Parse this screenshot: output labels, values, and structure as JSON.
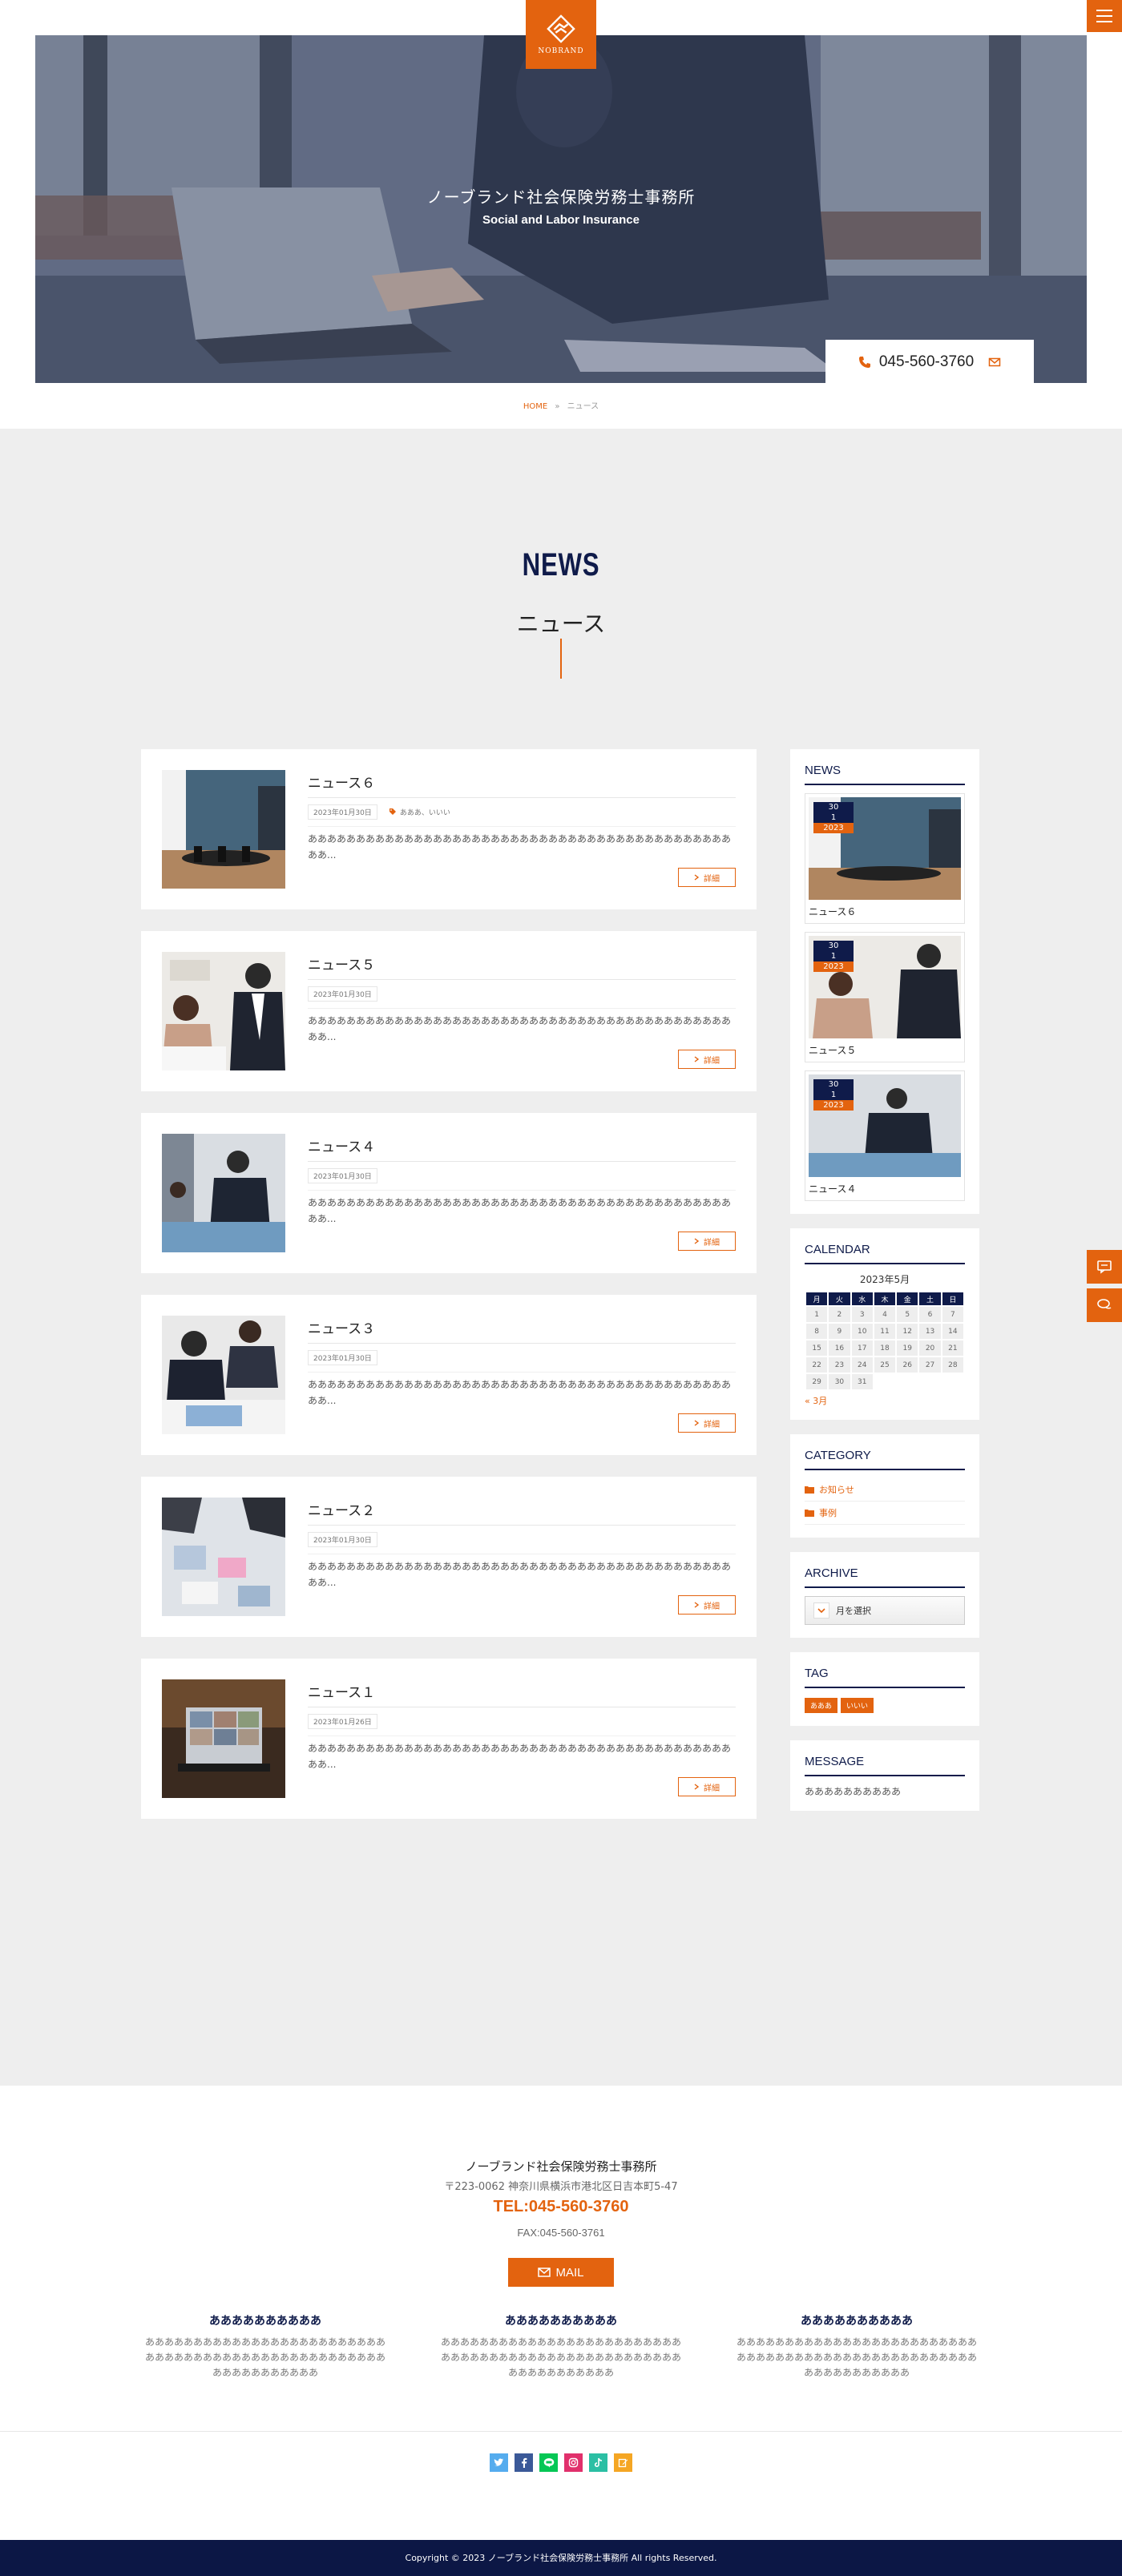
{
  "site": {
    "brand": "NOBRAND",
    "hero_title": "ノーブランド社会保険労務士事務所",
    "hero_subtitle": "Social and Labor Insurance",
    "tel": "045-560-3760"
  },
  "breadcrumb": {
    "home": "HOME",
    "sep": "»",
    "current": "ニュース"
  },
  "section": {
    "title_en": "NEWS",
    "title_jp": "ニュース"
  },
  "posts": [
    {
      "title": "ニュース６",
      "date": "2023年01月30日",
      "tag": "あああ、いいい",
      "excerpt": "ああああああああああああああああああああああああああああああああああああああああああああああ...",
      "more": "詳細"
    },
    {
      "title": "ニュース５",
      "date": "2023年01月30日",
      "tag": "",
      "excerpt": "ああああああああああああああああああああああああああああああああああああああああああああああ...",
      "more": "詳細"
    },
    {
      "title": "ニュース４",
      "date": "2023年01月30日",
      "tag": "",
      "excerpt": "ああああああああああああああああああああああああああああああああああああああああああああああ...",
      "more": "詳細"
    },
    {
      "title": "ニュース３",
      "date": "2023年01月30日",
      "tag": "",
      "excerpt": "ああああああああああああああああああああああああああああああああああああああああああああああ...",
      "more": "詳細"
    },
    {
      "title": "ニュース２",
      "date": "2023年01月30日",
      "tag": "",
      "excerpt": "ああああああああああああああああああああああああああああああああああああああああああああああ...",
      "more": "詳細"
    },
    {
      "title": "ニュース１",
      "date": "2023年01月26日",
      "tag": "",
      "excerpt": "ああああああああああああああああああああああああああああああああああああああああああああああ...",
      "more": "詳細"
    }
  ],
  "sidebar": {
    "news": {
      "title": "NEWS",
      "items": [
        {
          "day": "30",
          "month": "1",
          "year": "2023",
          "title": "ニュース６"
        },
        {
          "day": "30",
          "month": "1",
          "year": "2023",
          "title": "ニュース５"
        },
        {
          "day": "30",
          "month": "1",
          "year": "2023",
          "title": "ニュース４"
        }
      ]
    },
    "calendar": {
      "title": "CALENDAR",
      "caption": "2023年5月",
      "weekdays": [
        "月",
        "火",
        "水",
        "木",
        "金",
        "土",
        "日"
      ],
      "weeks": [
        [
          "1",
          "2",
          "3",
          "4",
          "5",
          "6",
          "7"
        ],
        [
          "8",
          "9",
          "10",
          "11",
          "12",
          "13",
          "14"
        ],
        [
          "15",
          "16",
          "17",
          "18",
          "19",
          "20",
          "21"
        ],
        [
          "22",
          "23",
          "24",
          "25",
          "26",
          "27",
          "28"
        ],
        [
          "29",
          "30",
          "31",
          "",
          "",
          "",
          ""
        ]
      ],
      "prev": "« 3月"
    },
    "category": {
      "title": "CATEGORY",
      "items": [
        "お知らせ",
        "事例"
      ]
    },
    "archive": {
      "title": "ARCHIVE",
      "select": "月を選択"
    },
    "tag": {
      "title": "TAG",
      "items": [
        "あああ",
        "いいい"
      ]
    },
    "message": {
      "title": "MESSAGE",
      "text": "ああああああああああ"
    }
  },
  "footer": {
    "name": "ノーブランド社会保険労務士事務所",
    "address": "〒223-0062 神奈川県横浜市港北区日吉本町5-47",
    "tel": "TEL:045-560-3760",
    "fax": "FAX:045-560-3761",
    "mail": "MAIL",
    "columns": [
      {
        "title": "ああああああああああ",
        "text": "あああああああああああああああああああああああああああああああああああああああああああああああああああああああああああああ"
      },
      {
        "title": "ああああああああああ",
        "text": "あああああああああああああああああああああああああああああああああああああああああああああああああああああああああああああ"
      },
      {
        "title": "ああああああああああ",
        "text": "あああああああああああああああああああああああああああああああああああああああああああああああああああああああああああああ"
      }
    ],
    "copyright": "Copyright © 2023 ノーブランド社会保険労務士事務所 All rights Reserved."
  },
  "colors": {
    "accent": "#e3630f",
    "navy": "#0f1b4a",
    "bg_gray": "#eeeeee",
    "footer_dark": "#0c1745"
  },
  "icons": [
    "hamburger-icon",
    "phone-icon",
    "mail-icon",
    "tag-icon",
    "chevron-right-icon",
    "folder-icon",
    "chevron-down-icon",
    "chat-icon",
    "comment-icon",
    "twitter-icon",
    "facebook-icon",
    "line-icon",
    "instagram-icon",
    "tiktok-icon",
    "note-icon"
  ]
}
